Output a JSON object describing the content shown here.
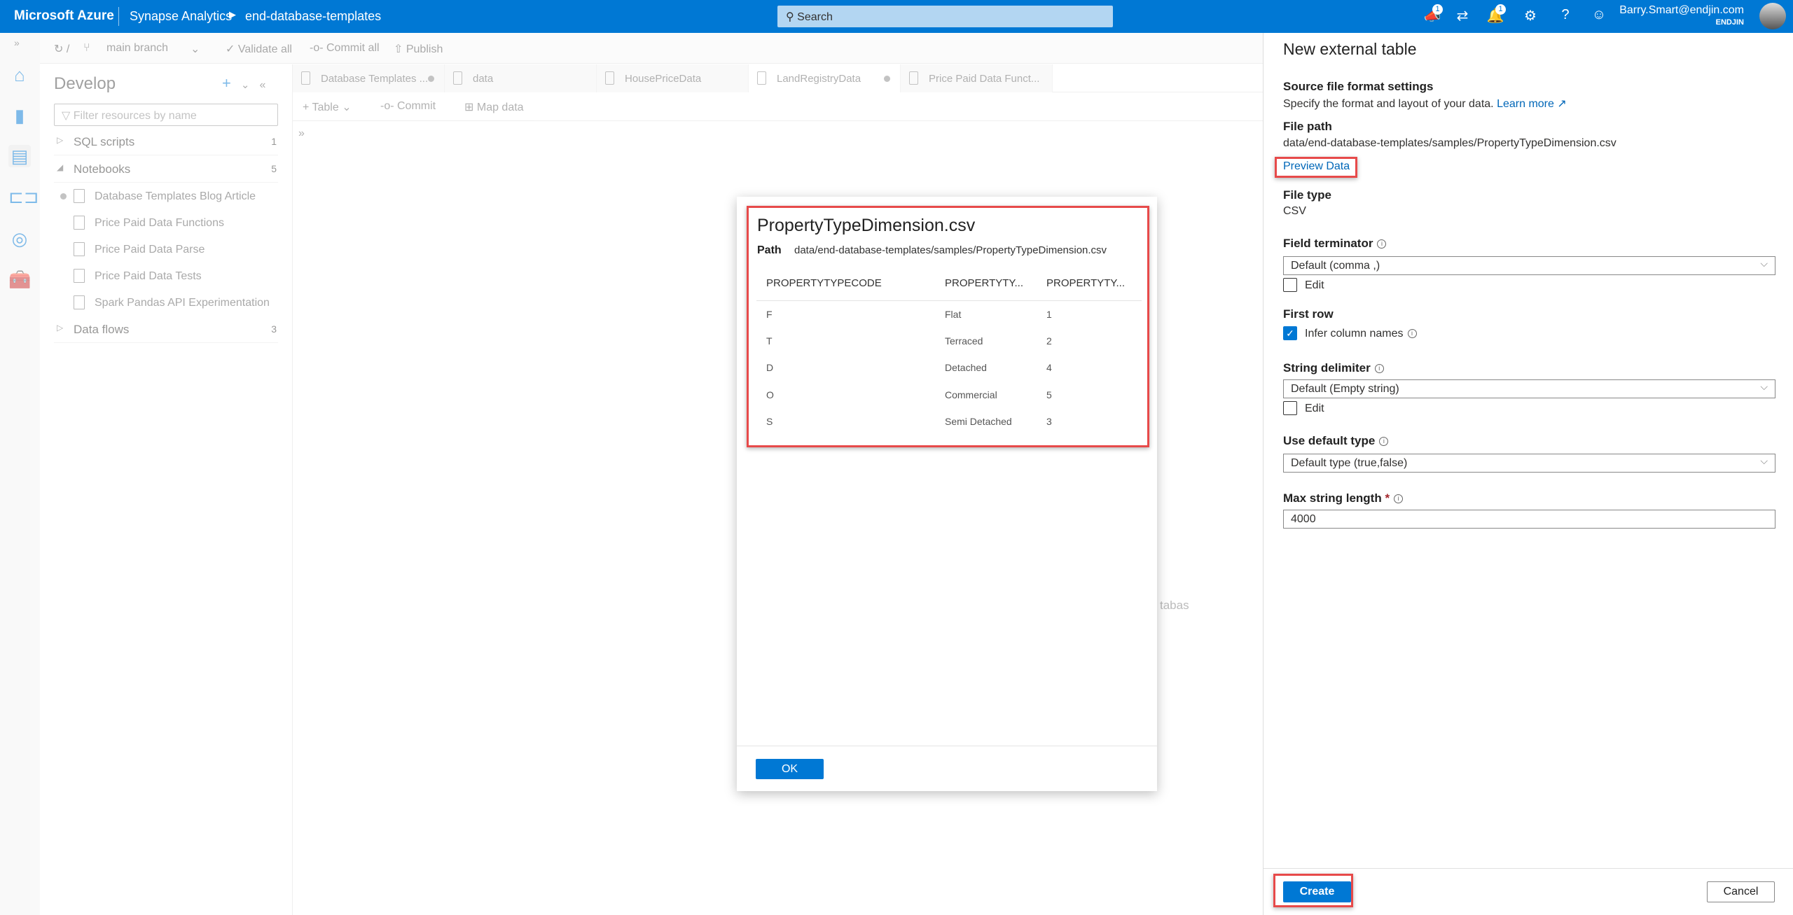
{
  "topbar": {
    "brand": "Microsoft Azure",
    "service": "Synapse Analytics",
    "workspace": "end-database-templates",
    "search_placeholder": "Search",
    "notifications_badge": "1",
    "announcements_badge": "1",
    "user": "Barry.Smart@endjin.com",
    "org": "ENDJIN"
  },
  "toolbar": {
    "branch": "main branch",
    "validate": "Validate all",
    "commit": "Commit all",
    "publish": "Publish"
  },
  "develop": {
    "title": "Develop",
    "filter_placeholder": "Filter resources by name",
    "groups": [
      {
        "label": "SQL scripts",
        "count": "1"
      },
      {
        "label": "Notebooks",
        "count": "5"
      },
      {
        "label": "Data flows",
        "count": "3"
      }
    ],
    "notebooks": [
      "Database Templates Blog Article",
      "Price Paid Data Functions",
      "Price Paid Data Parse",
      "Price Paid Data Tests",
      "Spark Pandas API Experimentation"
    ]
  },
  "tabs": [
    {
      "label": "Database Templates ..."
    },
    {
      "label": "data"
    },
    {
      "label": "HousePriceData"
    },
    {
      "label": "LandRegistryData"
    },
    {
      "label": "Price Paid Data Funct..."
    }
  ],
  "tabtool": {
    "table": "Table",
    "commit": "Commit",
    "map": "Map data"
  },
  "background_text": "tabas",
  "dialog": {
    "title": "PropertyTypeDimension.csv",
    "path_label": "Path",
    "path": "data/end-database-templates/samples/PropertyTypeDimension.csv",
    "columns": [
      "PROPERTYTYPECODE",
      "PROPERTYTY...",
      "PROPERTYTY..."
    ],
    "rows": [
      [
        "F",
        "Flat",
        "1"
      ],
      [
        "T",
        "Terraced",
        "2"
      ],
      [
        "D",
        "Detached",
        "4"
      ],
      [
        "O",
        "Commercial",
        "5"
      ],
      [
        "S",
        "Semi Detached",
        "3"
      ]
    ],
    "ok": "OK"
  },
  "panel": {
    "title": "New external table",
    "section": "Source file format settings",
    "desc": "Specify the format and layout of your data.",
    "learn_more": "Learn more",
    "file_path_label": "File path",
    "file_path": "data/end-database-templates/samples/PropertyTypeDimension.csv",
    "preview": "Preview Data",
    "file_type_label": "File type",
    "file_type": "CSV",
    "field_terminator_label": "Field terminator",
    "field_terminator": "Default (comma ,)",
    "edit": "Edit",
    "first_row_label": "First row",
    "infer": "Infer column names",
    "string_delim_label": "String delimiter",
    "string_delim": "Default (Empty string)",
    "default_type_label": "Use default type",
    "default_type": "Default type (true,false)",
    "max_len_label": "Max string length",
    "required": "*",
    "max_len": "4000",
    "create": "Create",
    "cancel": "Cancel"
  },
  "colors": {
    "accent": "#0078d4",
    "highlight": "#e74a4a"
  }
}
